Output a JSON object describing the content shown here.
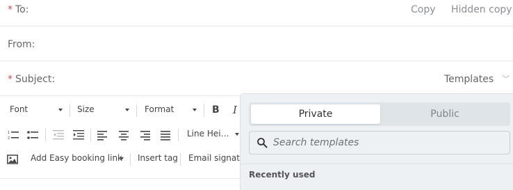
{
  "fields": {
    "to": {
      "required_mark": "*",
      "label": "To:"
    },
    "from": {
      "label": "From:"
    },
    "subject": {
      "required_mark": "*",
      "label": "Subject:"
    },
    "copy_label": "Copy",
    "hidden_copy_label": "Hidden copy",
    "templates_label": "Templates"
  },
  "toolbar": {
    "font_label": "Font",
    "size_label": "Size",
    "format_label": "Format",
    "bold_label": "B",
    "italic_label": "I",
    "line_height_label": "Line Hei…",
    "easy_booking_label": "Add Easy booking link",
    "insert_tag_label": "Insert tag",
    "email_signature_label": "Email signatur"
  },
  "templates_panel": {
    "tabs": {
      "private": "Private",
      "public": "Public"
    },
    "selected_tab": "Private",
    "search_placeholder": "Search templates",
    "recent_heading": "Recently used"
  },
  "icons": {
    "ordered_list": "ordered-list-icon",
    "unordered_list": "unordered-list-icon",
    "outdent": "outdent-icon",
    "indent": "indent-icon",
    "align_left": "align-left-icon",
    "align_center": "align-center-icon",
    "align_right": "align-right-icon",
    "align_justify": "align-justify-icon",
    "image": "image-icon",
    "search": "search-icon",
    "chevron": "chevron-down-icon"
  },
  "colors": {
    "required": "#e14b4b",
    "panel_bg": "#eef1f4",
    "segment_bg": "#dfe4e9"
  }
}
